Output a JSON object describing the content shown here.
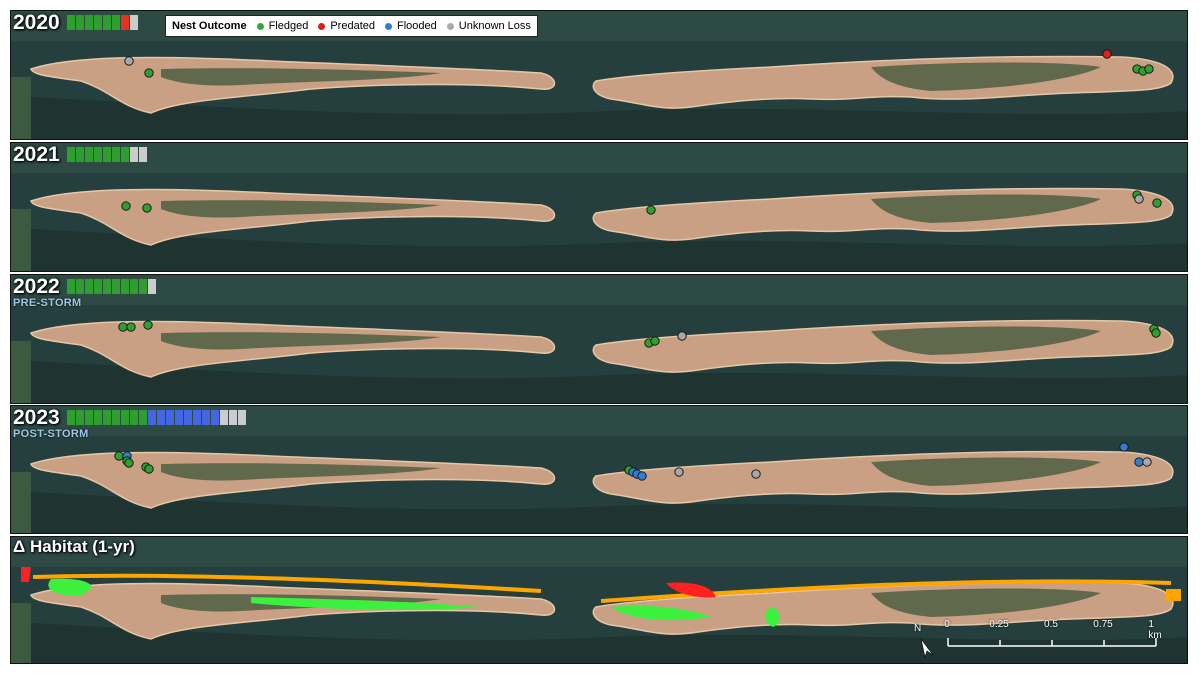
{
  "legend": {
    "title": "Nest Outcome",
    "items": [
      {
        "label": "Fledged",
        "color": "#3aa33a"
      },
      {
        "label": "Predated",
        "color": "#e01b1b"
      },
      {
        "label": "Flooded",
        "color": "#2f7fd0"
      },
      {
        "label": "Unknown Loss",
        "color": "#aaaaaa"
      }
    ]
  },
  "colors": {
    "fledged": "#2fa02f",
    "predated": "#e02020",
    "flooded": "#2f7fd0",
    "unknown": "#a8a8a8",
    "tally_fledged": "#2e9e2e",
    "tally_predated": "#e8321e",
    "tally_flooded": "#4466e0",
    "tally_unknown": "#cccccc",
    "water": "#243f3d",
    "sand": "#caa084",
    "vegetation": "#4f5f42",
    "gain": "#3ef03e",
    "loss": "#ff2020",
    "change": "#ffa500"
  },
  "panels": [
    {
      "year": "2020",
      "sublabel": "",
      "tally": {
        "fledged": 6,
        "predated": 1,
        "flooded": 0,
        "unknown": 1
      },
      "nests": [
        "unknown",
        "fledged",
        "predated",
        "fledged",
        "fledged",
        "fledged"
      ]
    },
    {
      "year": "2021",
      "sublabel": "",
      "tally": {
        "fledged": 7,
        "predated": 0,
        "flooded": 0,
        "unknown": 2
      },
      "nests": [
        "fledged",
        "fledged",
        "fledged",
        "fledged",
        "unknown",
        "fledged"
      ]
    },
    {
      "year": "2022",
      "sublabel": "PRE-STORM",
      "tally": {
        "fledged": 9,
        "predated": 0,
        "flooded": 0,
        "unknown": 1
      },
      "nests": [
        "fledged",
        "fledged",
        "fledged",
        "fledged",
        "fledged",
        "unknown",
        "fledged",
        "fledged"
      ]
    },
    {
      "year": "2023",
      "sublabel": "POST-STORM",
      "tally": {
        "fledged": 9,
        "predated": 0,
        "flooded": 8,
        "unknown": 3
      },
      "nests": [
        "fledged",
        "flooded",
        "fledged",
        "fledged",
        "fledged",
        "fledged",
        "fledged",
        "flooded",
        "flooded",
        "flooded",
        "unknown",
        "unknown",
        "flooded",
        "flooded",
        "unknown"
      ]
    }
  ],
  "habitat_panel": {
    "title": "Δ Habitat (1-yr)"
  },
  "north_label": "N",
  "scale": {
    "ticks": [
      "0",
      "0.25",
      "0.5",
      "0.75",
      "1 km"
    ]
  }
}
